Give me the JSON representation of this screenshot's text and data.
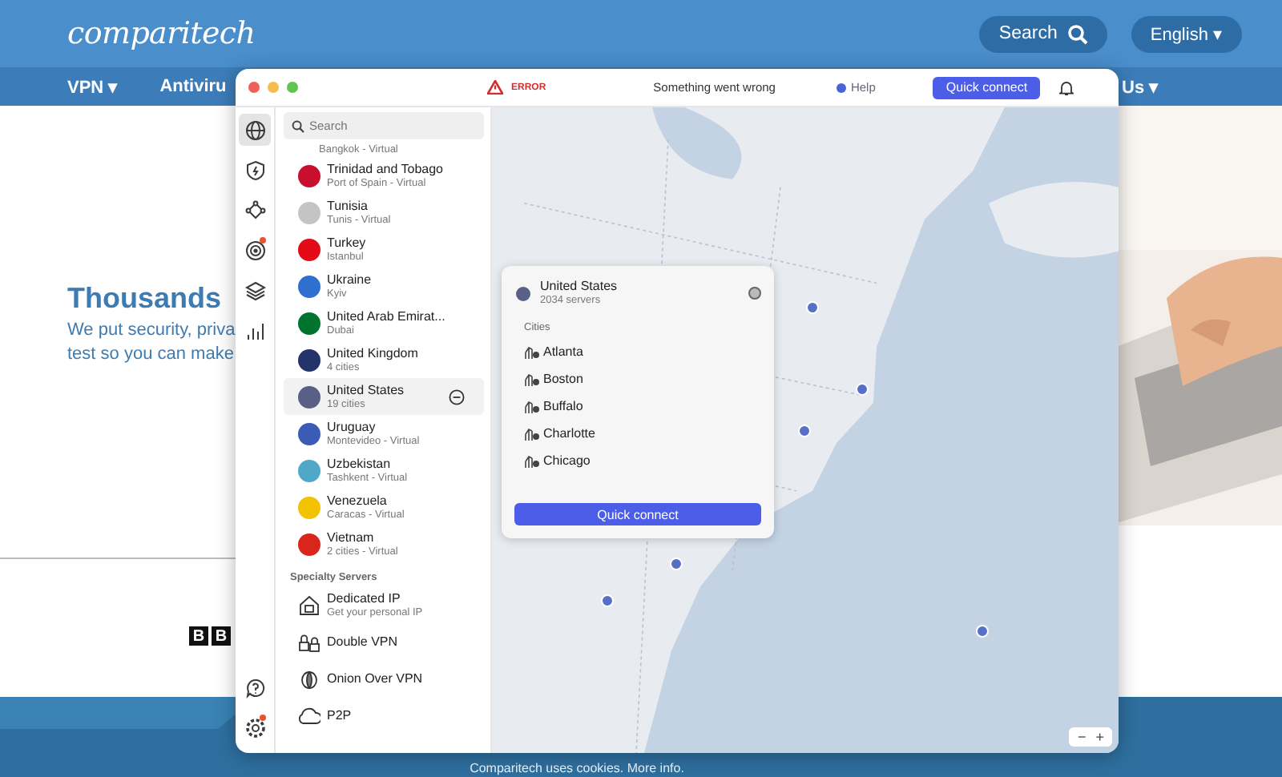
{
  "site": {
    "logo": "comparitech",
    "search_button": "Search",
    "language": "English ▾",
    "nav": [
      {
        "label": "VPN ▾"
      },
      {
        "label": "Antiviru"
      }
    ],
    "nav_right": "Us ▾",
    "heading": "Thousands",
    "lines": [
      "We put security, priva",
      "test so you can make"
    ],
    "press_logo": [
      "B",
      "B"
    ],
    "cookie_notice": "Comparitech uses cookies. More info."
  },
  "app": {
    "titlebar": {
      "status": "ERROR",
      "message": "Something went wrong",
      "help": "Help",
      "quick_connect": "Quick connect"
    },
    "rail": {
      "top": [
        {
          "selected": true,
          "alert": false
        },
        {
          "selected": false,
          "alert": false
        },
        {
          "selected": false,
          "alert": false
        },
        {
          "selected": false,
          "alert": true
        },
        {
          "selected": false,
          "alert": false
        },
        {
          "selected": false,
          "alert": false
        }
      ],
      "bottom": [
        {
          "selected": false,
          "alert": false
        },
        {
          "selected": false,
          "alert": true
        }
      ]
    },
    "search": {
      "placeholder": "Search"
    },
    "cut_row_detail": "Bangkok - Virtual",
    "countries": [
      {
        "name": "Trinidad and Tobago",
        "detail": "Port of Spain - Virtual",
        "color": "#c8102e",
        "selected": false
      },
      {
        "name": "Tunisia",
        "detail": "Tunis - Virtual",
        "color": "#c4c4c4",
        "selected": false
      },
      {
        "name": "Turkey",
        "detail": "Istanbul",
        "color": "#e30a17",
        "selected": false
      },
      {
        "name": "Ukraine",
        "detail": "Kyiv",
        "color": "#2f6fd0",
        "selected": false
      },
      {
        "name": "United Arab Emirat...",
        "detail": "Dubai",
        "color": "#00732f",
        "selected": false
      },
      {
        "name": "United Kingdom",
        "detail": "4 cities",
        "color": "#25336b",
        "selected": false
      },
      {
        "name": "United States",
        "detail": "19 cities",
        "color": "#5a5f86",
        "selected": true
      },
      {
        "name": "Uruguay",
        "detail": "Montevideo - Virtual",
        "color": "#3b5bb5",
        "selected": false
      },
      {
        "name": "Uzbekistan",
        "detail": "Tashkent - Virtual",
        "color": "#4fa8c8",
        "selected": false
      },
      {
        "name": "Venezuela",
        "detail": "Caracas - Virtual",
        "color": "#f2c200",
        "selected": false
      },
      {
        "name": "Vietnam",
        "detail": "2 cities - Virtual",
        "color": "#da251d",
        "selected": false
      }
    ],
    "specialty_heading": "Specialty Servers",
    "specialty": [
      {
        "kind": "dedicated",
        "name": "Dedicated IP",
        "detail": "Get your personal IP"
      },
      {
        "kind": "double",
        "name": "Double VPN"
      },
      {
        "kind": "onion",
        "name": "Onion Over VPN"
      },
      {
        "kind": "p2p",
        "name": "P2P"
      }
    ],
    "popup": {
      "selected": false,
      "country": "United States",
      "servers": "2034 servers",
      "color": "#5a5f86",
      "cities_heading": "Cities",
      "cities": [
        "Atlanta",
        "Boston",
        "Buffalo",
        "Charlotte",
        "Chicago"
      ],
      "button": "Quick connect"
    },
    "zoom": [
      "−",
      "+"
    ]
  }
}
